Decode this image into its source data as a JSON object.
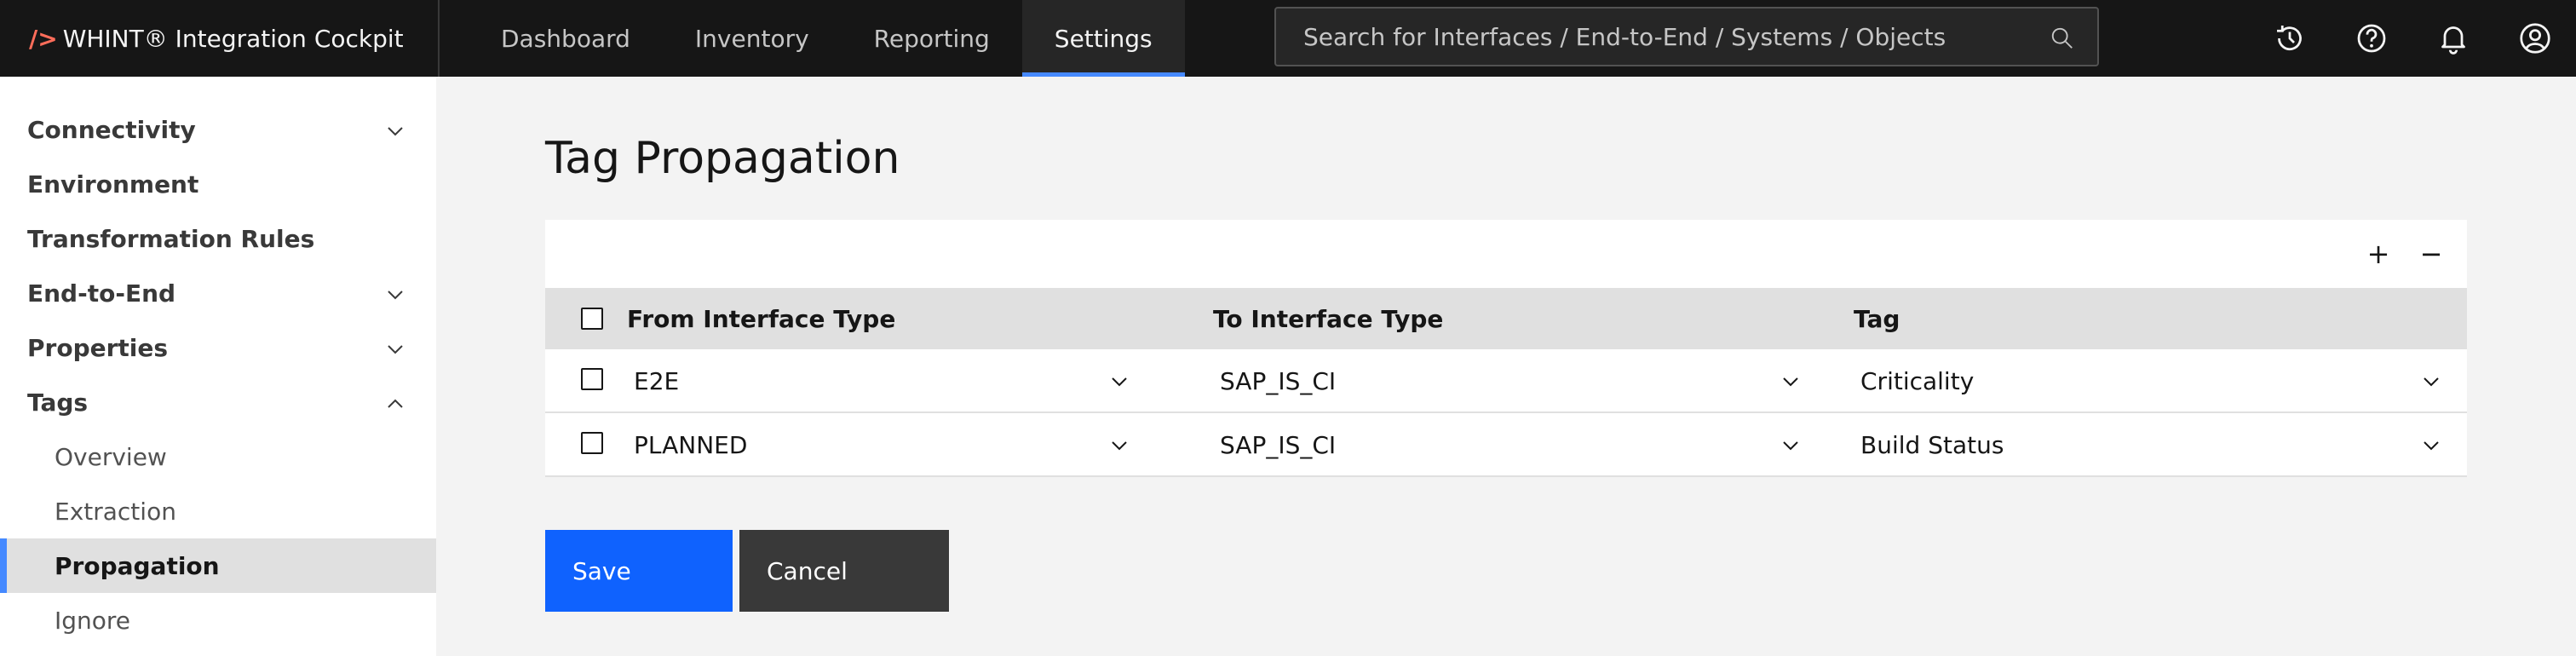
{
  "header": {
    "brand_slash": "/>",
    "brand_name": "WHINT® Integration Cockpit",
    "nav": [
      {
        "label": "Dashboard"
      },
      {
        "label": "Inventory"
      },
      {
        "label": "Reporting"
      },
      {
        "label": "Settings",
        "active": true
      }
    ],
    "search_placeholder": "Search for Interfaces / End-to-End / Systems / Objects",
    "icons": [
      "history-icon",
      "help-icon",
      "notification-icon",
      "user-avatar-icon"
    ]
  },
  "sidebar": {
    "items": [
      {
        "label": "Connectivity",
        "chevron": "down"
      },
      {
        "label": "Environment"
      },
      {
        "label": "Transformation Rules"
      },
      {
        "label": "End-to-End",
        "chevron": "down"
      },
      {
        "label": "Properties",
        "chevron": "down"
      },
      {
        "label": "Tags",
        "chevron": "up"
      }
    ],
    "sub_items": [
      {
        "label": "Overview"
      },
      {
        "label": "Extraction"
      },
      {
        "label": "Propagation",
        "active": true
      },
      {
        "label": "Ignore"
      }
    ]
  },
  "main": {
    "title": "Tag Propagation",
    "toolbar": {
      "add": "+",
      "remove": "−"
    },
    "columns": [
      "From Interface Type",
      "To Interface Type",
      "Tag"
    ],
    "rows": [
      {
        "from": "E2E",
        "to": "SAP_IS_CI",
        "tag": "Criticality"
      },
      {
        "from": "PLANNED",
        "to": "SAP_IS_CI",
        "tag": "Build Status"
      }
    ],
    "buttons": {
      "save": "Save",
      "cancel": "Cancel"
    }
  },
  "colors": {
    "header_bg": "#161616",
    "accent": "#0f62fe",
    "active_indicator": "#4589ff",
    "brand_slash": "#ff6d5a"
  }
}
